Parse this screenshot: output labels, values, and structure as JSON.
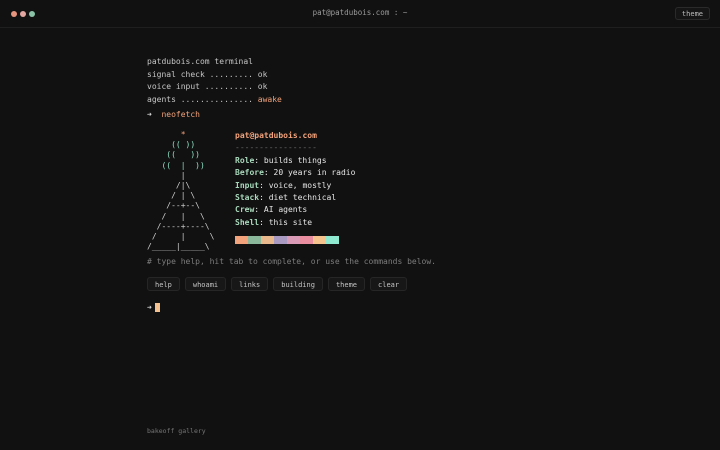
{
  "window": {
    "title": "pat@patdubois.com : ~",
    "theme_button": "theme"
  },
  "boot": {
    "line1": "patdubois.com terminal",
    "line2": "signal check ......... ok",
    "line3": "voice input .......... ok",
    "line4_prefix": "agents ............... ",
    "line4_status": "awake"
  },
  "prompt": {
    "arrow": "➜",
    "command": "neofetch"
  },
  "ascii_art": [
    "       *",
    "     (( ))",
    "    ((   ))",
    "   ((  |  ))",
    "       |",
    "      /|\\",
    "     / | \\",
    "    /--+--\\",
    "   /   |   \\",
    "  /----+----\\",
    " /     |     \\",
    "/_____|_____\\"
  ],
  "neofetch": {
    "user": "pat",
    "at": "@",
    "host": "patdubois.com",
    "separator": "-----------------",
    "rows": [
      {
        "key": "Role",
        "value": ": builds things"
      },
      {
        "key": "Before",
        "value": ": 20 years in radio"
      },
      {
        "key": "Input",
        "value": ": voice, mostly"
      },
      {
        "key": "Stack",
        "value": ": diet technical"
      },
      {
        "key": "Crew",
        "value": ": AI agents"
      },
      {
        "key": "Shell",
        "value": ": this site"
      }
    ],
    "swatches": [
      "#f2a37b",
      "#8bb89a",
      "#e7b98d",
      "#a99ac2",
      "#d99bb5",
      "#e98da0",
      "#f4c38e",
      "#8fe8d0"
    ]
  },
  "hint": "# type help, hit tab to complete, or use the commands below.",
  "commands": [
    "help",
    "whoami",
    "links",
    "building",
    "theme",
    "clear"
  ],
  "input": {
    "arrow": "➜"
  },
  "footer": "bakeoff gallery"
}
